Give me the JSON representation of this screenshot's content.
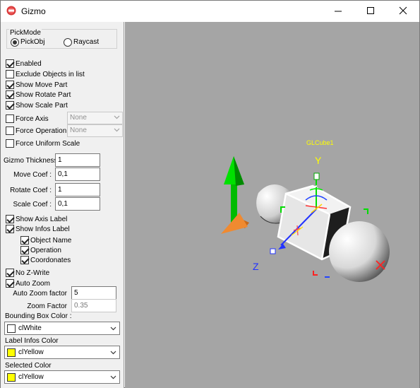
{
  "window": {
    "title": "Gizmo"
  },
  "pickmode": {
    "label": "PickMode",
    "options": [
      "PickObj",
      "Raycast"
    ],
    "selected": "PickObj"
  },
  "checks": {
    "enabled": {
      "label": "Enabled",
      "checked": true
    },
    "exclude": {
      "label": "Exclude Objects in list",
      "checked": false
    },
    "move": {
      "label": "Show Move Part",
      "checked": true
    },
    "rotate": {
      "label": "Show Rotate Part",
      "checked": true
    },
    "scale": {
      "label": "Show Scale Part",
      "checked": true
    },
    "force_axis": {
      "label": "Force Axis",
      "checked": false,
      "value": "None"
    },
    "force_op": {
      "label": "Force Operation",
      "checked": false,
      "value": "None"
    },
    "uniform": {
      "label": "Force Uniform Scale",
      "checked": false
    },
    "axis_label": {
      "label": "Show Axis Label",
      "checked": true
    },
    "infos_label": {
      "label": "Show Infos Label",
      "checked": true
    },
    "obj_name": {
      "label": "Object Name",
      "checked": true
    },
    "operation": {
      "label": "Operation",
      "checked": true
    },
    "coords": {
      "label": "Coordonates",
      "checked": true
    },
    "no_zwrite": {
      "label": "No Z-Write",
      "checked": true
    },
    "auto_zoom": {
      "label": "Auto Zoom",
      "checked": true
    }
  },
  "fields": {
    "thickness": {
      "label": "Gizmo Thickness",
      "value": "1"
    },
    "move_coef": {
      "label": "Move Coef :",
      "value": "0,1"
    },
    "rotate_coef": {
      "label": "Rotate Coef :",
      "value": "1"
    },
    "scale_coef": {
      "label": "Scale Coef :",
      "value": "0,1"
    },
    "auto_zoom_factor": {
      "label": "Auto Zoom factor",
      "value": "5"
    },
    "zoom_factor": {
      "label": "Zoom Factor",
      "value": "0.35"
    }
  },
  "colors": {
    "bbox": {
      "label": "Bounding Box Color :",
      "value": "clWhite",
      "swatch": "#ffffff"
    },
    "label_infos": {
      "label": "Label Infos Color",
      "value": "clYellow",
      "swatch": "#ffff00"
    },
    "selected": {
      "label": "Selected Color",
      "value": "clYellow",
      "swatch": "#ffff00"
    }
  },
  "scene": {
    "object_label": "GLCube1",
    "axis_y": "Y",
    "axis_z": "Z"
  }
}
